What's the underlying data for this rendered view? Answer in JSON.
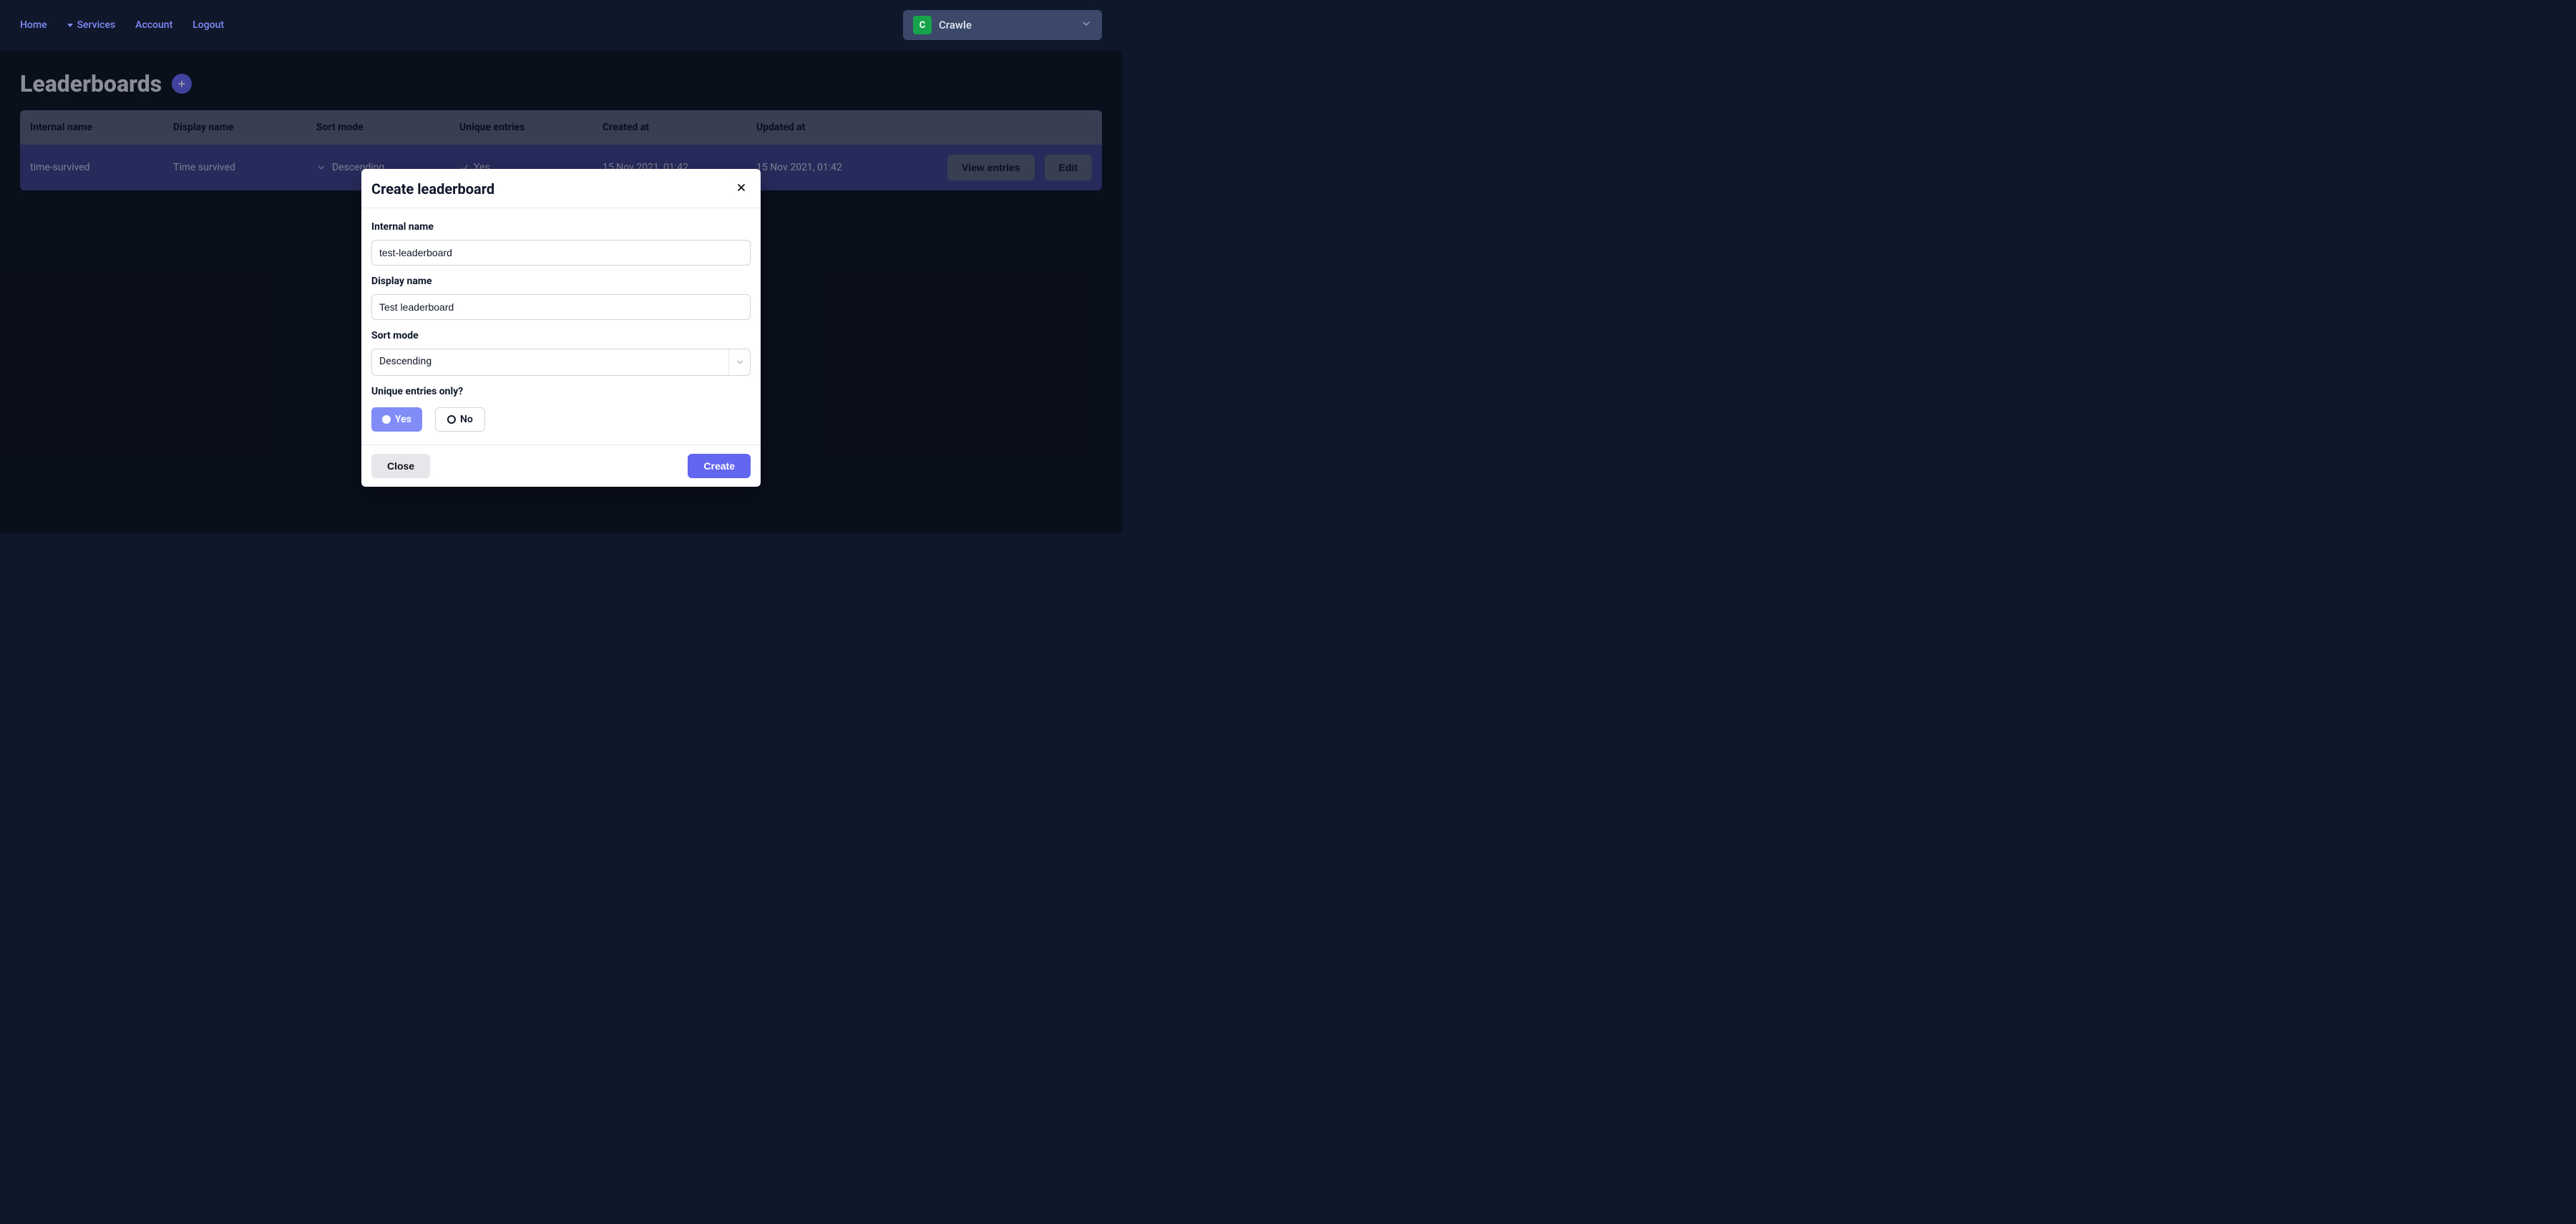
{
  "nav": {
    "home": "Home",
    "services": "Services",
    "account": "Account",
    "logout": "Logout"
  },
  "project_selector": {
    "badge_letter": "C",
    "name": "Crawle"
  },
  "page": {
    "title": "Leaderboards"
  },
  "table": {
    "headers": {
      "internal_name": "Internal name",
      "display_name": "Display name",
      "sort_mode": "Sort mode",
      "unique_entries": "Unique entries",
      "created_at": "Created at",
      "updated_at": "Updated at"
    },
    "rows": [
      {
        "internal_name": "time-survived",
        "display_name": "Time survived",
        "sort_mode": "Descending",
        "unique_entries": "Yes",
        "created_at": "15 Nov 2021, 01:42",
        "updated_at": "15 Nov 2021, 01:42"
      }
    ],
    "actions": {
      "view_entries": "View entries",
      "edit": "Edit"
    }
  },
  "modal": {
    "title": "Create leaderboard",
    "labels": {
      "internal_name": "Internal name",
      "display_name": "Display name",
      "sort_mode": "Sort mode",
      "unique_entries": "Unique entries only?"
    },
    "fields": {
      "internal_name": "test-leaderboard",
      "display_name": "Test leaderboard",
      "sort_mode": "Descending"
    },
    "radio": {
      "yes": "Yes",
      "no": "No"
    },
    "buttons": {
      "close": "Close",
      "create": "Create"
    }
  }
}
